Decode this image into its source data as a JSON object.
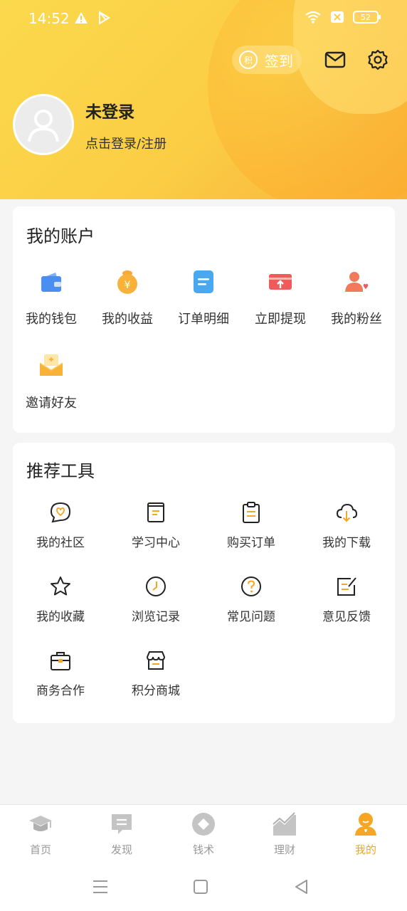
{
  "status": {
    "time": "14:52",
    "battery": "52",
    "left_icons": [
      "warning-icon",
      "play-store-icon"
    ],
    "right_icons": [
      "wifi-icon",
      "close-box-icon",
      "battery-icon"
    ]
  },
  "header": {
    "signin_coin": "积",
    "signin_label": "签到",
    "user_name": "未登录",
    "login_hint": "点击登录/注册"
  },
  "account": {
    "title": "我的账户",
    "items": [
      {
        "label": "我的钱包",
        "icon": "wallet-icon"
      },
      {
        "label": "我的收益",
        "icon": "money-bag-icon"
      },
      {
        "label": "订单明细",
        "icon": "order-list-icon"
      },
      {
        "label": "立即提现",
        "icon": "withdraw-card-icon"
      },
      {
        "label": "我的粉丝",
        "icon": "fans-icon"
      },
      {
        "label": "邀请好友",
        "icon": "invite-envelope-icon"
      }
    ]
  },
  "tools": {
    "title": "推荐工具",
    "items": [
      {
        "label": "我的社区",
        "icon": "community-icon"
      },
      {
        "label": "学习中心",
        "icon": "study-book-icon"
      },
      {
        "label": "购买订单",
        "icon": "clipboard-icon"
      },
      {
        "label": "我的下载",
        "icon": "cloud-download-icon"
      },
      {
        "label": "我的收藏",
        "icon": "star-icon"
      },
      {
        "label": "浏览记录",
        "icon": "clock-icon"
      },
      {
        "label": "常见问题",
        "icon": "question-icon"
      },
      {
        "label": "意见反馈",
        "icon": "feedback-edit-icon"
      },
      {
        "label": "商务合作",
        "icon": "briefcase-icon"
      },
      {
        "label": "积分商城",
        "icon": "store-icon"
      }
    ]
  },
  "tabbar": {
    "tabs": [
      {
        "label": "首页",
        "icon": "graduation-cap-icon",
        "active": false
      },
      {
        "label": "发现",
        "icon": "message-box-icon",
        "active": false
      },
      {
        "label": "钱术",
        "icon": "diamond-circle-icon",
        "active": false
      },
      {
        "label": "理财",
        "icon": "trend-chart-icon",
        "active": false
      },
      {
        "label": "我的",
        "icon": "profile-icon",
        "active": true
      }
    ]
  },
  "colors": {
    "accent": "#f5a623",
    "header_yellow": "#fbd94d",
    "icon_blue": "#4a8ef0",
    "icon_orange": "#f8b23a",
    "icon_red": "#f05a5a"
  }
}
